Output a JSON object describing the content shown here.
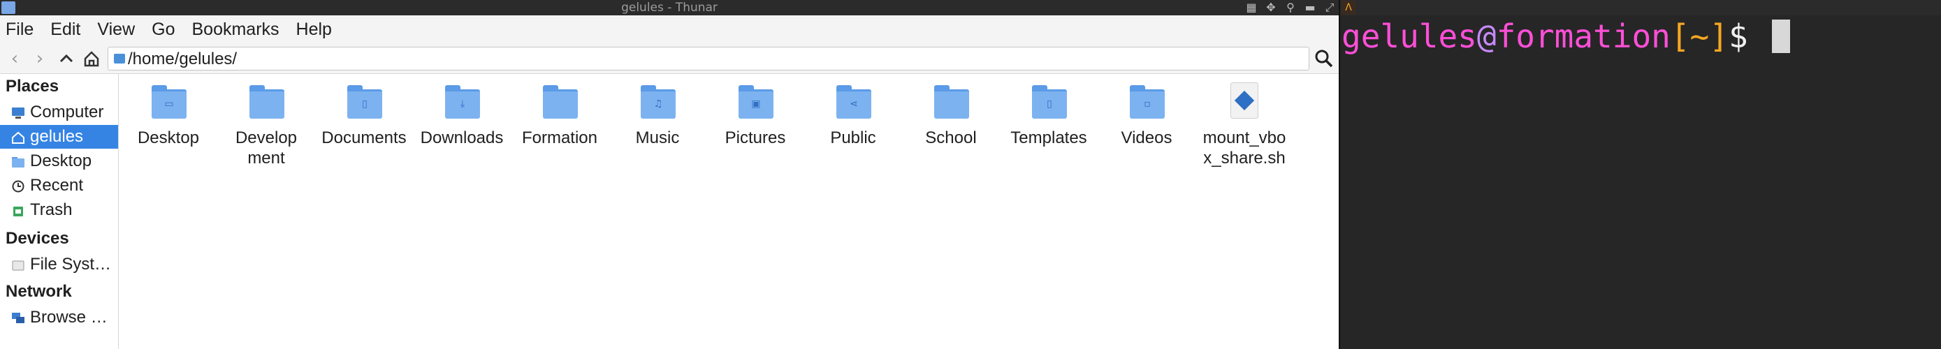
{
  "thunar": {
    "window_title": "gelules - Thunar",
    "menu": [
      "File",
      "Edit",
      "View",
      "Go",
      "Bookmarks",
      "Help"
    ],
    "location": "/home/gelules/",
    "sidebar": {
      "places_header": "Places",
      "places": [
        {
          "label": "Computer",
          "icon": "computer-icon"
        },
        {
          "label": "gelules",
          "icon": "home-icon",
          "active": true
        },
        {
          "label": "Desktop",
          "icon": "desktop-folder-icon"
        },
        {
          "label": "Recent",
          "icon": "clock-icon"
        },
        {
          "label": "Trash",
          "icon": "trash-icon"
        }
      ],
      "devices_header": "Devices",
      "devices": [
        {
          "label": "File Syst…",
          "icon": "drive-icon"
        }
      ],
      "network_header": "Network",
      "network": [
        {
          "label": "Browse …",
          "icon": "network-icon"
        }
      ]
    },
    "files": [
      {
        "name": "Desktop",
        "type": "folder",
        "emblem": "▭"
      },
      {
        "name": "Development",
        "type": "folder",
        "emblem": ""
      },
      {
        "name": "Documents",
        "type": "folder",
        "emblem": "▯"
      },
      {
        "name": "Downloads",
        "type": "folder",
        "emblem": "⤓"
      },
      {
        "name": "Formation",
        "type": "folder",
        "emblem": ""
      },
      {
        "name": "Music",
        "type": "folder",
        "emblem": "♫"
      },
      {
        "name": "Pictures",
        "type": "folder",
        "emblem": "▣"
      },
      {
        "name": "Public",
        "type": "folder",
        "emblem": "⋖"
      },
      {
        "name": "School",
        "type": "folder",
        "emblem": ""
      },
      {
        "name": "Templates",
        "type": "folder",
        "emblem": "▯"
      },
      {
        "name": "Videos",
        "type": "folder",
        "emblem": "▫"
      },
      {
        "name": "mount_vbox_share.sh",
        "type": "script",
        "emblem": ""
      }
    ]
  },
  "terminal": {
    "prompt_user": "gelules",
    "prompt_at": "@",
    "prompt_host": "formation",
    "prompt_open": "[",
    "prompt_path": "~",
    "prompt_close": "]",
    "prompt_dollar": "$",
    "app_icon_glyph": "Λ"
  },
  "colors": {
    "selection": "#3584e4",
    "folder": "#7db2f0",
    "prompt_pink": "#ff4fd8",
    "prompt_orange": "#f5a623"
  }
}
